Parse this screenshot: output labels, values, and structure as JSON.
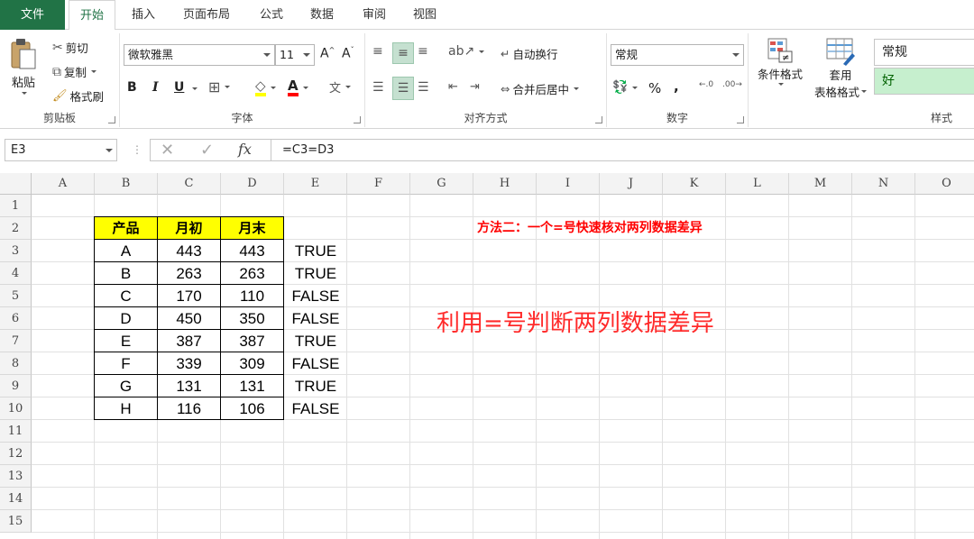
{
  "tabs": {
    "file": "文件",
    "home": "开始",
    "insert": "插入",
    "page_layout": "页面布局",
    "formulas": "公式",
    "data": "数据",
    "review": "审阅",
    "view": "视图"
  },
  "ribbon": {
    "clipboard": {
      "paste": "粘贴",
      "cut": "剪切",
      "copy": "复制",
      "format_painter": "格式刷",
      "title": "剪贴板"
    },
    "font": {
      "font_name": "微软雅黑",
      "font_size": "11",
      "bold": "B",
      "italic": "I",
      "underline": "U",
      "title": "字体"
    },
    "alignment": {
      "wrap_text": "自动换行",
      "merge_center": "合并后居中",
      "title": "对齐方式"
    },
    "number": {
      "format": "常规",
      "percent": "%",
      "comma": ",",
      "title": "数字"
    },
    "styles": {
      "conditional_format": "条件格式",
      "table_format_1": "套用",
      "table_format_2": "表格格式",
      "style_normal": "常规",
      "style_good": "好",
      "title": "样式"
    }
  },
  "formula_bar": {
    "name_box": "E3",
    "fx": "fx",
    "formula": "=C3=D3"
  },
  "sheet": {
    "columns": [
      "A",
      "B",
      "C",
      "D",
      "E",
      "F",
      "G",
      "H",
      "I",
      "J",
      "K",
      "L",
      "M",
      "N",
      "O"
    ],
    "rows": [
      "1",
      "2",
      "3",
      "4",
      "5",
      "6",
      "7",
      "8",
      "9",
      "10",
      "11",
      "12",
      "13",
      "14",
      "15"
    ],
    "table_headers": [
      "产品",
      "月初",
      "月末"
    ],
    "table_rows": [
      [
        "A",
        "443",
        "443",
        "TRUE"
      ],
      [
        "B",
        "263",
        "263",
        "TRUE"
      ],
      [
        "C",
        "170",
        "110",
        "FALSE"
      ],
      [
        "D",
        "450",
        "350",
        "FALSE"
      ],
      [
        "E",
        "387",
        "387",
        "TRUE"
      ],
      [
        "F",
        "339",
        "309",
        "FALSE"
      ],
      [
        "G",
        "131",
        "131",
        "TRUE"
      ],
      [
        "H",
        "116",
        "106",
        "FALSE"
      ]
    ],
    "note_title": "方法二：一个=号快速核对两列数据差异",
    "note_big": "利用=号判断两列数据差异"
  },
  "colors": {
    "excel_green": "#217346",
    "header_fill": "#ffff00",
    "note_red": "#ff0000",
    "good_style_fill": "#c6efce"
  }
}
